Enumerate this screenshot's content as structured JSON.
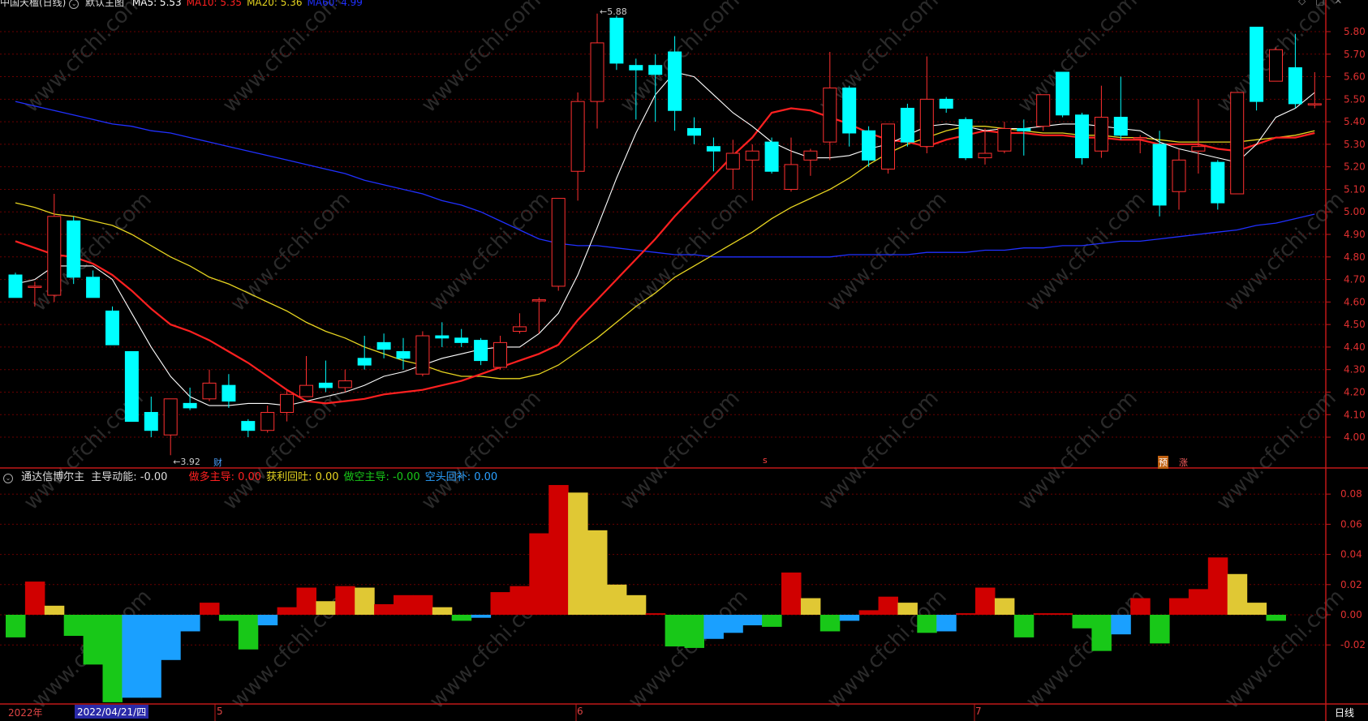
{
  "header": {
    "title": "中国天楹(日线)",
    "mode": "默认主图",
    "ma_labels": [
      {
        "text": "MA5: 5.53",
        "color": "#ffffff"
      },
      {
        "text": "MA10: 5.35",
        "color": "#ff2020"
      },
      {
        "text": "MA20: 5.36",
        "color": "#e6d420"
      },
      {
        "text": "MA60: 4.99",
        "color": "#2030ff"
      }
    ]
  },
  "indicator": {
    "name": "通达信博尔主",
    "main_label": "主导动能: -0.00",
    "items": [
      {
        "label": "做多主导: 0.00",
        "color": "#ff2020"
      },
      {
        "label": "获利回吐: 0.00",
        "color": "#e6d420"
      },
      {
        "label": "做空主导: -0.00",
        "color": "#18c818"
      },
      {
        "label": "空头回补: 0.00",
        "color": "#2aa0ff"
      }
    ]
  },
  "markers": {
    "high_label": "5.88",
    "low_label": "3.92",
    "cai": "财",
    "s": "s",
    "yu": "预",
    "zhang": "涨"
  },
  "xaxis": {
    "year": "2022年",
    "selected_date": "2022/04/21/四",
    "months": [
      "5",
      "6",
      "7"
    ]
  },
  "period_label": "日线",
  "colors": {
    "up": "#ff3030",
    "down": "#00ffff",
    "ma5": "#ffffff",
    "ma10": "#ff2020",
    "ma20": "#e6d420",
    "ma60": "#2030ff",
    "grid": "#6a0000",
    "axis": "#c01818",
    "ind_red": "#d00000",
    "ind_yellow": "#e0c834",
    "ind_green": "#18c818",
    "ind_blue": "#1aa0ff"
  },
  "chart_data": {
    "type": "candlestick",
    "price_ticks": [
      5.8,
      5.7,
      5.6,
      5.5,
      5.4,
      5.3,
      5.2,
      5.1,
      5.0,
      4.9,
      4.8,
      4.7,
      4.6,
      4.5,
      4.4,
      4.3,
      4.2,
      4.1,
      4.0
    ],
    "price_tick_labels": [
      "5.80",
      "5.70",
      "5.60",
      "5.50",
      "5.40",
      "5.30",
      "5.20",
      "5.10",
      "5.00",
      "4.90",
      "4.80",
      "4.70",
      "4.60",
      "4.50",
      "4.40",
      "4.30",
      "4.20",
      "4.10",
      "4.00"
    ],
    "ind_ticks": [
      0.08,
      0.06,
      0.04,
      0.02,
      0.0,
      -0.02
    ],
    "ind_tick_labels": [
      "0.08",
      "0.06",
      "0.04",
      "0.02",
      "0.00",
      "-0.02"
    ],
    "candles": [
      {
        "o": 4.72,
        "h": 4.73,
        "l": 4.62,
        "c": 4.62
      },
      {
        "o": 4.67,
        "h": 4.69,
        "l": 4.58,
        "c": 4.67
      },
      {
        "o": 4.63,
        "h": 5.08,
        "l": 4.6,
        "c": 4.98
      },
      {
        "o": 4.96,
        "h": 4.98,
        "l": 4.68,
        "c": 4.71
      },
      {
        "o": 4.71,
        "h": 4.74,
        "l": 4.62,
        "c": 4.62
      },
      {
        "o": 4.56,
        "h": 4.58,
        "l": 4.41,
        "c": 4.41
      },
      {
        "o": 4.38,
        "h": 4.38,
        "l": 4.07,
        "c": 4.07
      },
      {
        "o": 4.11,
        "h": 4.18,
        "l": 4.0,
        "c": 4.03
      },
      {
        "o": 4.01,
        "h": 4.17,
        "l": 3.92,
        "c": 4.17
      },
      {
        "o": 4.15,
        "h": 4.22,
        "l": 4.12,
        "c": 4.13
      },
      {
        "o": 4.17,
        "h": 4.3,
        "l": 4.16,
        "c": 4.24
      },
      {
        "o": 4.23,
        "h": 4.28,
        "l": 4.13,
        "c": 4.16
      },
      {
        "o": 4.07,
        "h": 4.08,
        "l": 4.0,
        "c": 4.03
      },
      {
        "o": 4.03,
        "h": 4.14,
        "l": 4.02,
        "c": 4.11
      },
      {
        "o": 4.11,
        "h": 4.21,
        "l": 4.07,
        "c": 4.19
      },
      {
        "o": 4.18,
        "h": 4.36,
        "l": 4.18,
        "c": 4.23
      },
      {
        "o": 4.24,
        "h": 4.34,
        "l": 4.2,
        "c": 4.22
      },
      {
        "o": 4.22,
        "h": 4.3,
        "l": 4.2,
        "c": 4.25
      },
      {
        "o": 4.35,
        "h": 4.45,
        "l": 4.3,
        "c": 4.32
      },
      {
        "o": 4.42,
        "h": 4.46,
        "l": 4.35,
        "c": 4.39
      },
      {
        "o": 4.38,
        "h": 4.44,
        "l": 4.3,
        "c": 4.35
      },
      {
        "o": 4.28,
        "h": 4.47,
        "l": 4.27,
        "c": 4.45
      },
      {
        "o": 4.45,
        "h": 4.51,
        "l": 4.4,
        "c": 4.44
      },
      {
        "o": 4.44,
        "h": 4.48,
        "l": 4.4,
        "c": 4.42
      },
      {
        "o": 4.43,
        "h": 4.44,
        "l": 4.32,
        "c": 4.34
      },
      {
        "o": 4.31,
        "h": 4.45,
        "l": 4.3,
        "c": 4.42
      },
      {
        "o": 4.47,
        "h": 4.55,
        "l": 4.46,
        "c": 4.49
      },
      {
        "o": 4.61,
        "h": 4.62,
        "l": 4.46,
        "c": 4.61
      },
      {
        "o": 4.67,
        "h": 5.06,
        "l": 4.65,
        "c": 5.06
      },
      {
        "o": 5.18,
        "h": 5.53,
        "l": 5.05,
        "c": 5.49
      },
      {
        "o": 5.49,
        "h": 5.88,
        "l": 5.37,
        "c": 5.75
      },
      {
        "o": 5.86,
        "h": 5.87,
        "l": 5.63,
        "c": 5.66
      },
      {
        "o": 5.65,
        "h": 5.68,
        "l": 5.41,
        "c": 5.63
      },
      {
        "o": 5.65,
        "h": 5.7,
        "l": 5.4,
        "c": 5.61
      },
      {
        "o": 5.71,
        "h": 5.78,
        "l": 5.36,
        "c": 5.45
      },
      {
        "o": 5.37,
        "h": 5.42,
        "l": 5.3,
        "c": 5.34
      },
      {
        "o": 5.29,
        "h": 5.33,
        "l": 5.18,
        "c": 5.27
      },
      {
        "o": 5.19,
        "h": 5.32,
        "l": 5.1,
        "c": 5.26
      },
      {
        "o": 5.23,
        "h": 5.3,
        "l": 5.05,
        "c": 5.27
      },
      {
        "o": 5.31,
        "h": 5.33,
        "l": 5.17,
        "c": 5.18
      },
      {
        "o": 5.1,
        "h": 5.33,
        "l": 5.09,
        "c": 5.21
      },
      {
        "o": 5.23,
        "h": 5.28,
        "l": 5.16,
        "c": 5.27
      },
      {
        "o": 5.31,
        "h": 5.71,
        "l": 5.23,
        "c": 5.55
      },
      {
        "o": 5.55,
        "h": 5.56,
        "l": 5.29,
        "c": 5.35
      },
      {
        "o": 5.36,
        "h": 5.38,
        "l": 5.2,
        "c": 5.23
      },
      {
        "o": 5.19,
        "h": 5.39,
        "l": 5.17,
        "c": 5.39
      },
      {
        "o": 5.46,
        "h": 5.48,
        "l": 5.29,
        "c": 5.31
      },
      {
        "o": 5.29,
        "h": 5.69,
        "l": 5.26,
        "c": 5.5
      },
      {
        "o": 5.5,
        "h": 5.51,
        "l": 5.44,
        "c": 5.46
      },
      {
        "o": 5.41,
        "h": 5.42,
        "l": 5.23,
        "c": 5.24
      },
      {
        "o": 5.24,
        "h": 5.37,
        "l": 5.21,
        "c": 5.26
      },
      {
        "o": 5.27,
        "h": 5.4,
        "l": 5.26,
        "c": 5.37
      },
      {
        "o": 5.37,
        "h": 5.41,
        "l": 5.25,
        "c": 5.36
      },
      {
        "o": 5.38,
        "h": 5.52,
        "l": 5.36,
        "c": 5.52
      },
      {
        "o": 5.62,
        "h": 5.62,
        "l": 5.42,
        "c": 5.43
      },
      {
        "o": 5.43,
        "h": 5.44,
        "l": 5.21,
        "c": 5.24
      },
      {
        "o": 5.27,
        "h": 5.56,
        "l": 5.24,
        "c": 5.42
      },
      {
        "o": 5.42,
        "h": 5.6,
        "l": 5.32,
        "c": 5.34
      },
      {
        "o": 5.33,
        "h": 5.34,
        "l": 5.26,
        "c": 5.33
      },
      {
        "o": 5.3,
        "h": 5.36,
        "l": 4.98,
        "c": 5.03
      },
      {
        "o": 5.09,
        "h": 5.28,
        "l": 5.01,
        "c": 5.23
      },
      {
        "o": 5.27,
        "h": 5.5,
        "l": 5.17,
        "c": 5.29
      },
      {
        "o": 5.22,
        "h": 5.23,
        "l": 5.01,
        "c": 5.04
      },
      {
        "o": 5.08,
        "h": 5.53,
        "l": 5.08,
        "c": 5.53
      },
      {
        "o": 5.82,
        "h": 5.82,
        "l": 5.45,
        "c": 5.49
      },
      {
        "o": 5.58,
        "h": 5.73,
        "l": 5.58,
        "c": 5.72
      },
      {
        "o": 5.64,
        "h": 5.79,
        "l": 5.46,
        "c": 5.48
      },
      {
        "o": 5.48,
        "h": 5.62,
        "l": 5.46,
        "c": 5.48
      }
    ],
    "ma5": [
      4.68,
      4.7,
      4.76,
      4.76,
      4.76,
      4.7,
      4.55,
      4.4,
      4.27,
      4.18,
      4.14,
      4.14,
      4.15,
      4.15,
      4.14,
      4.16,
      4.18,
      4.2,
      4.23,
      4.27,
      4.29,
      4.32,
      4.35,
      4.37,
      4.39,
      4.4,
      4.4,
      4.46,
      4.55,
      4.72,
      4.93,
      5.15,
      5.35,
      5.52,
      5.62,
      5.6,
      5.52,
      5.44,
      5.38,
      5.31,
      5.27,
      5.24,
      5.24,
      5.25,
      5.28,
      5.3,
      5.34,
      5.38,
      5.39,
      5.38,
      5.36,
      5.37,
      5.37,
      5.38,
      5.39,
      5.39,
      5.38,
      5.37,
      5.36,
      5.31,
      5.28,
      5.26,
      5.24,
      5.22,
      5.3,
      5.42,
      5.46,
      5.53
    ],
    "ma10": [
      4.87,
      4.84,
      4.81,
      4.8,
      4.77,
      4.72,
      4.65,
      4.57,
      4.5,
      4.47,
      4.43,
      4.38,
      4.33,
      4.27,
      4.21,
      4.16,
      4.15,
      4.16,
      4.17,
      4.19,
      4.2,
      4.21,
      4.23,
      4.25,
      4.28,
      4.31,
      4.34,
      4.37,
      4.41,
      4.52,
      4.61,
      4.7,
      4.79,
      4.88,
      4.98,
      5.07,
      5.16,
      5.25,
      5.33,
      5.44,
      5.46,
      5.45,
      5.42,
      5.39,
      5.35,
      5.32,
      5.31,
      5.29,
      5.32,
      5.34,
      5.36,
      5.35,
      5.35,
      5.34,
      5.34,
      5.33,
      5.33,
      5.32,
      5.32,
      5.3,
      5.3,
      5.3,
      5.28,
      5.27,
      5.3,
      5.33,
      5.33,
      5.35
    ],
    "ma20": [
      5.04,
      5.02,
      4.99,
      4.98,
      4.96,
      4.94,
      4.9,
      4.85,
      4.8,
      4.76,
      4.71,
      4.68,
      4.64,
      4.6,
      4.56,
      4.51,
      4.47,
      4.44,
      4.4,
      4.37,
      4.34,
      4.32,
      4.29,
      4.27,
      4.27,
      4.26,
      4.26,
      4.28,
      4.32,
      4.38,
      4.44,
      4.51,
      4.58,
      4.64,
      4.71,
      4.76,
      4.81,
      4.86,
      4.91,
      4.97,
      5.02,
      5.06,
      5.1,
      5.15,
      5.21,
      5.26,
      5.3,
      5.33,
      5.36,
      5.38,
      5.38,
      5.37,
      5.36,
      5.35,
      5.35,
      5.34,
      5.34,
      5.33,
      5.33,
      5.32,
      5.31,
      5.31,
      5.31,
      5.31,
      5.32,
      5.33,
      5.34,
      5.36
    ],
    "ma60": [
      5.49,
      5.47,
      5.45,
      5.43,
      5.41,
      5.39,
      5.38,
      5.36,
      5.35,
      5.33,
      5.31,
      5.29,
      5.27,
      5.25,
      5.23,
      5.21,
      5.19,
      5.17,
      5.14,
      5.12,
      5.1,
      5.08,
      5.05,
      5.03,
      5.0,
      4.96,
      4.92,
      4.88,
      4.86,
      4.85,
      4.85,
      4.84,
      4.83,
      4.82,
      4.81,
      4.81,
      4.8,
      4.8,
      4.8,
      4.8,
      4.8,
      4.8,
      4.8,
      4.81,
      4.81,
      4.81,
      4.81,
      4.82,
      4.82,
      4.82,
      4.83,
      4.83,
      4.84,
      4.84,
      4.85,
      4.85,
      4.86,
      4.87,
      4.87,
      4.88,
      4.89,
      4.9,
      4.91,
      4.92,
      4.94,
      4.95,
      4.97,
      4.99
    ],
    "indicator_bars": [
      {
        "v": -0.015,
        "c": "green"
      },
      {
        "v": 0.022,
        "c": "red"
      },
      {
        "v": 0.006,
        "c": "yellow"
      },
      {
        "v": -0.014,
        "c": "green"
      },
      {
        "v": -0.033,
        "c": "green"
      },
      {
        "v": -0.058,
        "c": "green"
      },
      {
        "v": -0.055,
        "c": "blue"
      },
      {
        "v": -0.055,
        "c": "blue"
      },
      {
        "v": -0.03,
        "c": "blue"
      },
      {
        "v": -0.011,
        "c": "blue"
      },
      {
        "v": 0.008,
        "c": "red"
      },
      {
        "v": -0.004,
        "c": "green"
      },
      {
        "v": -0.023,
        "c": "green"
      },
      {
        "v": -0.007,
        "c": "blue"
      },
      {
        "v": 0.005,
        "c": "red"
      },
      {
        "v": 0.018,
        "c": "red"
      },
      {
        "v": 0.009,
        "c": "yellow"
      },
      {
        "v": 0.019,
        "c": "red"
      },
      {
        "v": 0.018,
        "c": "yellow"
      },
      {
        "v": 0.007,
        "c": "red"
      },
      {
        "v": 0.013,
        "c": "red"
      },
      {
        "v": 0.013,
        "c": "red"
      },
      {
        "v": 0.005,
        "c": "yellow"
      },
      {
        "v": -0.004,
        "c": "green"
      },
      {
        "v": -0.002,
        "c": "blue"
      },
      {
        "v": 0.015,
        "c": "red"
      },
      {
        "v": 0.019,
        "c": "red"
      },
      {
        "v": 0.054,
        "c": "red"
      },
      {
        "v": 0.086,
        "c": "red"
      },
      {
        "v": 0.081,
        "c": "yellow"
      },
      {
        "v": 0.056,
        "c": "yellow"
      },
      {
        "v": 0.02,
        "c": "yellow"
      },
      {
        "v": 0.013,
        "c": "yellow"
      },
      {
        "v": 0.001,
        "c": "red"
      },
      {
        "v": -0.021,
        "c": "green"
      },
      {
        "v": -0.022,
        "c": "green"
      },
      {
        "v": -0.016,
        "c": "blue"
      },
      {
        "v": -0.012,
        "c": "blue"
      },
      {
        "v": -0.007,
        "c": "blue"
      },
      {
        "v": -0.008,
        "c": "green"
      },
      {
        "v": 0.028,
        "c": "red"
      },
      {
        "v": 0.011,
        "c": "yellow"
      },
      {
        "v": -0.011,
        "c": "green"
      },
      {
        "v": -0.004,
        "c": "blue"
      },
      {
        "v": 0.003,
        "c": "red"
      },
      {
        "v": 0.012,
        "c": "red"
      },
      {
        "v": 0.008,
        "c": "yellow"
      },
      {
        "v": -0.012,
        "c": "green"
      },
      {
        "v": -0.011,
        "c": "blue"
      },
      {
        "v": 0.001,
        "c": "red"
      },
      {
        "v": 0.018,
        "c": "red"
      },
      {
        "v": 0.011,
        "c": "yellow"
      },
      {
        "v": -0.015,
        "c": "green"
      },
      {
        "v": 0.001,
        "c": "red"
      },
      {
        "v": 0.001,
        "c": "red"
      },
      {
        "v": -0.009,
        "c": "green"
      },
      {
        "v": -0.024,
        "c": "green"
      },
      {
        "v": -0.013,
        "c": "blue"
      },
      {
        "v": 0.011,
        "c": "red"
      },
      {
        "v": -0.019,
        "c": "green"
      },
      {
        "v": 0.011,
        "c": "red"
      },
      {
        "v": 0.017,
        "c": "red"
      },
      {
        "v": 0.038,
        "c": "red"
      },
      {
        "v": 0.027,
        "c": "yellow"
      },
      {
        "v": 0.008,
        "c": "yellow"
      },
      {
        "v": -0.004,
        "c": "green"
      }
    ]
  }
}
